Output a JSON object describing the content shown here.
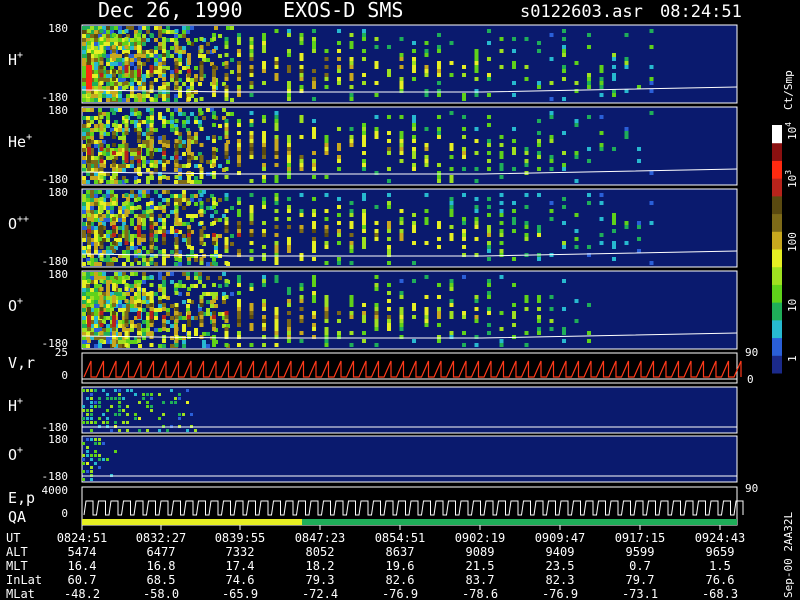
{
  "header": {
    "date": "Dec 26, 1990",
    "instrument": "EXOS-D SMS",
    "file": "s0122603.asr",
    "time": "08:24:51"
  },
  "colors": {
    "background": "#000000",
    "panel_bg": "#0a1a6e",
    "axis": "#ffffff",
    "trace": "#ffffff",
    "velocity_trace": "#ff3a1a",
    "colorscale": [
      "#1b2a8a",
      "#2a5fd8",
      "#27b9d0",
      "#1fae59",
      "#5fd21a",
      "#9fe020",
      "#e6ef23",
      "#c8a81e",
      "#7d6a18",
      "#5a4a10",
      "#b8231b",
      "#ff2a10",
      "#8a1010",
      "#ffffff"
    ]
  },
  "colorbar": {
    "unit": "Ct/Smp",
    "labels": [
      "1",
      "10",
      "100",
      "10",
      "10"
    ],
    "exponents": [
      "",
      "",
      "",
      "3",
      "4"
    ]
  },
  "panels": [
    {
      "id": "h-plus",
      "base": "H",
      "sup": "+",
      "top_tick": "180",
      "bottom_tick": "-180",
      "activity": 0.95,
      "reach": 0.88
    },
    {
      "id": "he-plus",
      "base": "He",
      "sup": "+",
      "top_tick": "180",
      "bottom_tick": "-180",
      "activity": 0.7,
      "reach": 0.87
    },
    {
      "id": "o-plus-plus",
      "base": "O",
      "sup": "++",
      "top_tick": "180",
      "bottom_tick": "-180",
      "activity": 0.75,
      "reach": 0.87
    },
    {
      "id": "o-plus",
      "base": "O",
      "sup": "+",
      "top_tick": "180",
      "bottom_tick": "-180",
      "activity": 0.85,
      "reach": 0.79
    }
  ],
  "velocity_panel": {
    "label": "V,r",
    "top_tick": "25",
    "zero_tick": "0",
    "right_top": "90",
    "right_zero": "0"
  },
  "low_panels": [
    {
      "id": "h-plus-low",
      "base": "H",
      "sup": "+",
      "top_tick": "",
      "bottom_tick": "-180"
    },
    {
      "id": "o-plus-low",
      "base": "O",
      "sup": "+",
      "top_tick": "180",
      "bottom_tick": "-180"
    }
  ],
  "ep_panel": {
    "label1": "E,p",
    "label2": "QA",
    "top_tick": "4000",
    "zero_tick": "0",
    "right_tick": "90"
  },
  "ephemeris": {
    "rows": [
      {
        "label": "UT",
        "values": [
          "0824:51",
          "0832:27",
          "0839:55",
          "0847:23",
          "0854:51",
          "0902:19",
          "0909:47",
          "0917:15",
          "0924:43"
        ]
      },
      {
        "label": "ALT",
        "values": [
          "5474",
          "6477",
          "7332",
          "8052",
          "8637",
          "9089",
          "9409",
          "9599",
          "9659"
        ]
      },
      {
        "label": "MLT",
        "values": [
          "16.4",
          "16.8",
          "17.4",
          "18.2",
          "19.6",
          "21.5",
          "23.5",
          "0.7",
          "1.5"
        ]
      },
      {
        "label": "InLat",
        "values": [
          "60.7",
          "68.5",
          "74.6",
          "79.3",
          "82.6",
          "83.7",
          "82.3",
          "79.7",
          "76.6"
        ]
      },
      {
        "label": "MLat",
        "values": [
          "-48.2",
          "-58.0",
          "-65.9",
          "-72.4",
          "-76.9",
          "-78.6",
          "-76.9",
          "-73.1",
          "-68.3"
        ]
      }
    ],
    "side_note": "Sep-00  2AA32L"
  },
  "chart_data": {
    "type": "heatmap",
    "title": "Dec 26, 1990   EXOS-D SMS",
    "x_ticks_ut": [
      "0824:51",
      "0832:27",
      "0839:55",
      "0847:23",
      "0854:51",
      "0902:19",
      "0909:47",
      "0917:15",
      "0924:43"
    ],
    "y_range_pitch": [
      -180,
      180
    ],
    "series": [
      "H+",
      "He+",
      "O++",
      "O+",
      "V,r",
      "H+",
      "O+",
      "E,p",
      "QA"
    ],
    "color_scale": "log",
    "color_range": [
      1,
      10000
    ],
    "colorbar_unit": "Ct/Smp",
    "velocity_range": [
      0,
      25
    ],
    "energy_range": [
      0,
      4000
    ]
  }
}
